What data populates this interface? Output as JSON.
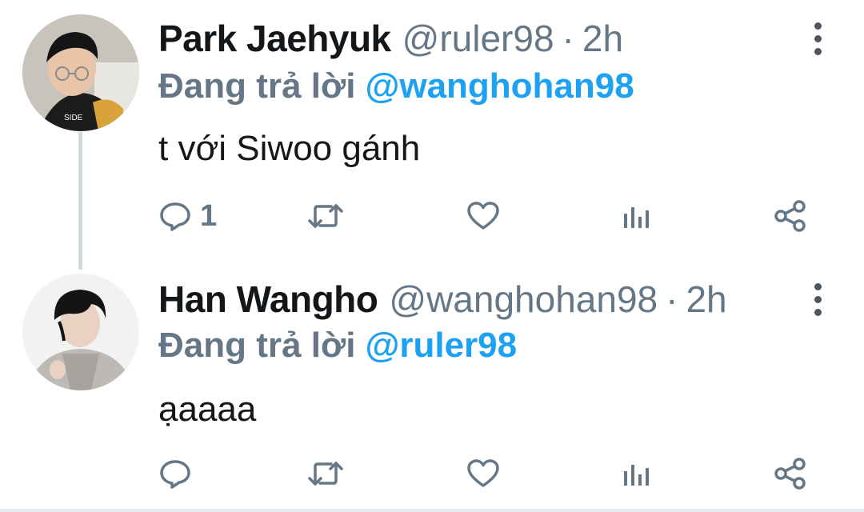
{
  "tweets": [
    {
      "display_name": "Park Jaehyuk",
      "handle": "@ruler98",
      "separator": "·",
      "time": "2h",
      "reply_prefix": "Đang trả lời",
      "reply_mention": "@wanghohan98",
      "text": "t với Siwoo gánh",
      "actions": {
        "reply_icon": "reply-icon",
        "reply_count": "1",
        "retweet_icon": "retweet-icon",
        "like_icon": "heart-icon",
        "analytics_icon": "analytics-icon",
        "share_icon": "share-icon"
      },
      "menu_icon": "more-vertical-icon",
      "has_thread_line": true
    },
    {
      "display_name": "Han Wangho",
      "handle": "@wanghohan98",
      "separator": "·",
      "time": "2h",
      "reply_prefix": "Đang trả lời",
      "reply_mention": "@ruler98",
      "text": "ạaaaa",
      "actions": {
        "reply_icon": "reply-icon",
        "reply_count": "",
        "retweet_icon": "retweet-icon",
        "like_icon": "heart-icon",
        "analytics_icon": "analytics-icon",
        "share_icon": "share-icon"
      },
      "menu_icon": "more-vertical-icon",
      "has_thread_line": false
    }
  ],
  "colors": {
    "text_primary": "#14171a",
    "text_secondary": "#657786",
    "link": "#1da1f2",
    "thread_line": "#cfd9de",
    "icon": "#657786"
  }
}
